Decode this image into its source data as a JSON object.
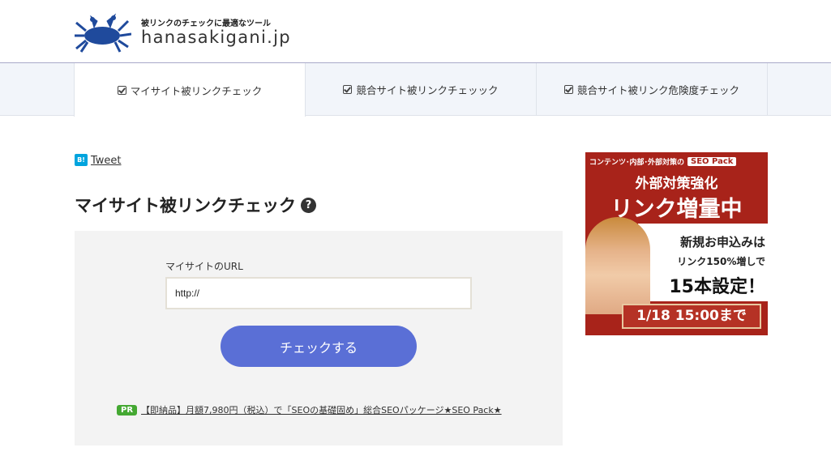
{
  "header": {
    "tagline": "被リンクのチェックに最適なツール",
    "site_name": "hanasakigani.jp",
    "logo_icon": "crab-logo-icon",
    "logo_color": "#1f4a9c"
  },
  "nav": {
    "tabs": [
      {
        "label": "マイサイト被リンクチェック",
        "active": true
      },
      {
        "label": "競合サイト被リンクチェッック",
        "active": false
      },
      {
        "label": "競合サイト被リンク危険度チェック",
        "active": false
      }
    ]
  },
  "social": {
    "hatebu_label": "B!",
    "tweet_label": "Tweet"
  },
  "main": {
    "title": "マイサイト被リンクチェック",
    "help_glyph": "?",
    "form": {
      "url_label": "マイサイトのURL",
      "url_value": "http://",
      "submit_label": "チェックする"
    },
    "pr": {
      "badge": "PR",
      "text": "【即納品】月額7,980円（税込）で「SEOの基礎固め」総合SEOパッケージ★SEO Pack★"
    }
  },
  "ad": {
    "top_text": "コンテンツ･内部･外部対策の",
    "brand": "SEO Pack",
    "headline1": "外部対策強化",
    "headline2": "リンク増量中",
    "line1": "新規お申込みは",
    "line2": "リンク150%増しで",
    "line3": "15本設定！",
    "deadline": "1/18 15:00まで"
  },
  "colors": {
    "button": "#5a6fd6",
    "ad_background": "#a8231a",
    "pr_badge": "#44a832",
    "hatebu": "#00a4de"
  }
}
